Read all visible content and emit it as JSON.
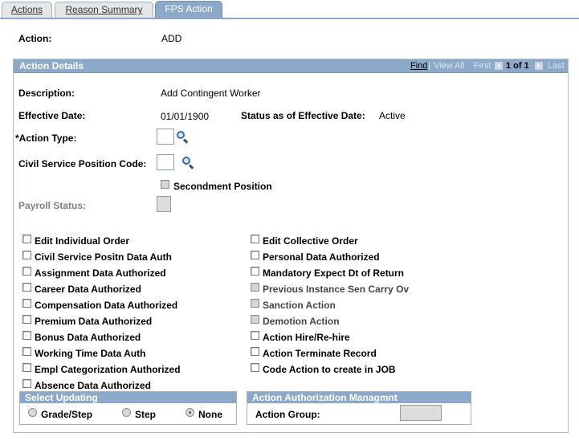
{
  "tabs": [
    {
      "label": "Actions",
      "active": false
    },
    {
      "label": "Reason Summary",
      "active": false
    },
    {
      "label": "FPS Action",
      "active": true
    }
  ],
  "action": {
    "label": "Action:",
    "value": "ADD"
  },
  "panel": {
    "title": "Action Details",
    "nav": {
      "find": "Find",
      "view_all": "View All",
      "first": "First",
      "counter": "1 of 1",
      "last": "Last"
    }
  },
  "fields": {
    "description": {
      "label": "Description:",
      "value": "Add Contingent Worker"
    },
    "effective_date": {
      "label": "Effective Date:",
      "value": "01/01/1900"
    },
    "status_as_of": {
      "label": "Status as of Effective Date:",
      "value": "Active"
    },
    "action_type": {
      "label": "*Action Type:",
      "value": ""
    },
    "civil_service_position_code": {
      "label": "Civil Service Position Code:",
      "value": ""
    },
    "secondment_position": {
      "label": "Secondment Position",
      "checked": false
    },
    "payroll_status": {
      "label": "Payroll Status:",
      "value": ""
    }
  },
  "checkboxes_left": [
    {
      "label": "Edit Individual Order",
      "checked": false,
      "disabled": false
    },
    {
      "label": "Civil Service Positn Data Auth",
      "checked": false,
      "disabled": false
    },
    {
      "label": "Assignment Data Authorized",
      "checked": false,
      "disabled": false
    },
    {
      "label": "Career Data Authorized",
      "checked": false,
      "disabled": false
    },
    {
      "label": "Compensation Data Authorized",
      "checked": false,
      "disabled": false
    },
    {
      "label": "Premium Data Authorized",
      "checked": false,
      "disabled": false
    },
    {
      "label": "Bonus Data Authorized",
      "checked": false,
      "disabled": false
    },
    {
      "label": "Working Time Data Auth",
      "checked": false,
      "disabled": false
    },
    {
      "label": "Empl Categorization Authorized",
      "checked": false,
      "disabled": false
    },
    {
      "label": "Absence Data Authorized",
      "checked": false,
      "disabled": false
    }
  ],
  "checkboxes_right": [
    {
      "label": "Edit Collective Order",
      "checked": false,
      "disabled": false
    },
    {
      "label": "Personal Data Authorized",
      "checked": false,
      "disabled": false
    },
    {
      "label": "Mandatory Expect Dt of Return",
      "checked": false,
      "disabled": false
    },
    {
      "label": "Previous Instance Sen Carry Ov",
      "checked": false,
      "disabled": true
    },
    {
      "label": "Sanction Action",
      "checked": false,
      "disabled": true
    },
    {
      "label": "Demotion Action",
      "checked": false,
      "disabled": true
    },
    {
      "label": "Action Hire/Re-hire",
      "checked": false,
      "disabled": false
    },
    {
      "label": "Action Terminate Record",
      "checked": false,
      "disabled": false
    },
    {
      "label": "Code Action to create in JOB",
      "checked": false,
      "disabled": false
    }
  ],
  "select_updating": {
    "title": "Select Updating",
    "options": [
      {
        "label": "Grade/Step",
        "selected": false
      },
      {
        "label": "Step",
        "selected": false
      },
      {
        "label": "None",
        "selected": true
      }
    ]
  },
  "authorization": {
    "title": "Action Authorization Managmnt",
    "group_label": "Action Group:",
    "group_value": ""
  }
}
